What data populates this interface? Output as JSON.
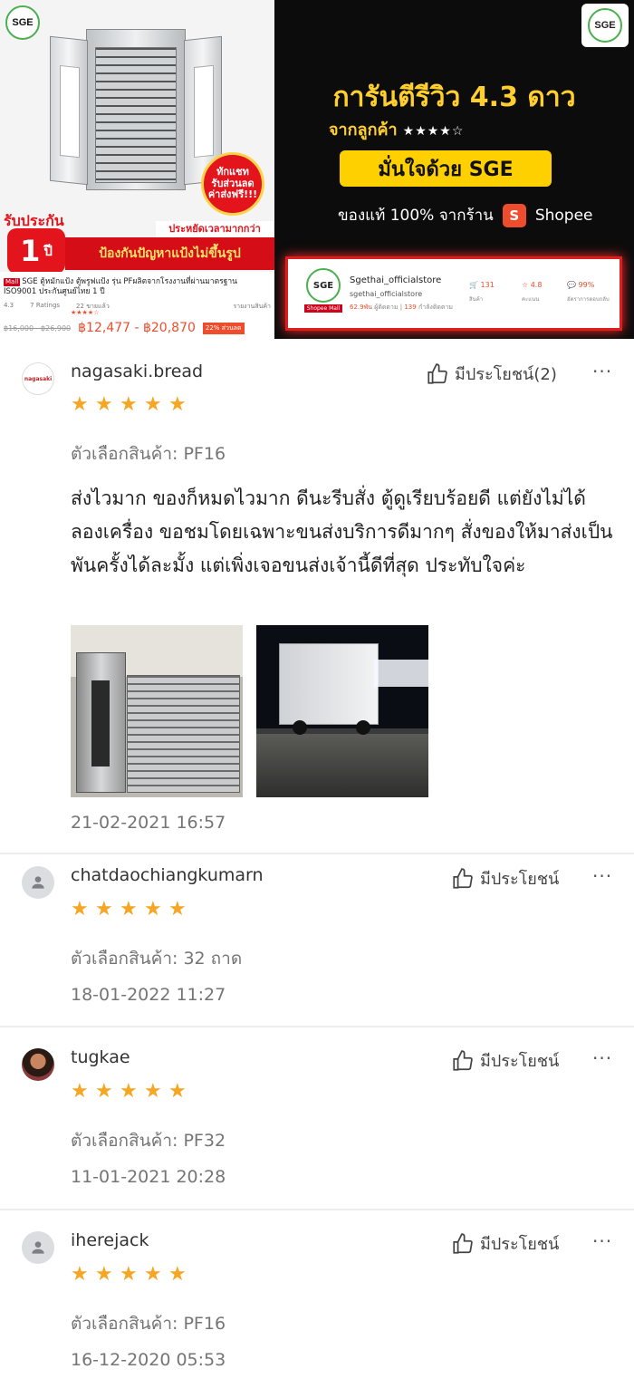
{
  "banner": {
    "left": {
      "logo_text": "SGE",
      "badge_lines": [
        "ทักแชท",
        "รับส่วนลด",
        "ค่าส่งฟรี!!!"
      ],
      "warranty_title": "รับประกัน",
      "warranty_number": "1",
      "warranty_unit": "ปี",
      "save_time": "ประหยัดเวลามากกว่า",
      "prevent_text": "ป้องกันปัญหาแป้งไม่ขึ้นรูป",
      "mall_tag": "Mall",
      "product_title": "SGE ตู้หมักแป้ง ตู้พรูฟแป้ง รุ่น PFผลิตจากโรงงานที่ผ่านมาตรฐาน ISO9001 ประกันศูนย์ไทย 1 ปี",
      "rating": "4.3",
      "rating_stars": "★★★★☆",
      "ratings_count": "7 Ratings",
      "sold": "22",
      "sold_label": "ขายแล้ว",
      "report": "รายงานสินค้า",
      "price_old": "฿16,000 - ฿26,900",
      "price_new": "฿12,477 - ฿20,870",
      "discount": "22% ส่วนลด"
    },
    "right": {
      "logo_text": "SGE",
      "guarantee": "การันตีรีวิว 4.3 ดาว",
      "from_customer": "จากลูกค้า",
      "from_customer_stars": "★★★★☆",
      "confident": "มั่นใจด้วย SGE",
      "authentic": "ของแท้ 100% จากร้าน",
      "shopee_icon": "S",
      "shopee": "Shopee",
      "store": {
        "logo_text": "SGE",
        "mall_label": "Shopee Mall",
        "name": "Sgethai_officialstore",
        "handle": "sgethai_officialstore",
        "followers": "62.9พัน",
        "followers_label": "ผู้ติดตาม",
        "following": "139",
        "following_label": "กำลังติดตาม",
        "products": "131",
        "products_label": "สินค้า",
        "score": "4.8",
        "score_label": "คะแนน",
        "chat_rate": "99%",
        "chat_rate_label": "อัตราการตอบกลับ"
      }
    }
  },
  "reviews": [
    {
      "username": "nagasaki.bread",
      "avatar_icon": "nagasaki-logo",
      "helpful": "มีประโยชน์(2)",
      "stars": 5,
      "variation": "ตัวเลือกสินค้า: PF16",
      "text": "ส่งไวมาก ของก็หมดไวมาก ดีนะรีบสั่ง ตู้ดูเรียบร้อยดี แต่ยังไม่ได้ลองเครื่อง ขอชมโดยเฉพาะขนส่งบริการดีมากๆ สั่งของให้มาส่งเป็นพันครั้งได้ละมั้ง แต่เพิ่งเจอขนส่งเจ้านี้ดีที่สุด ประทับใจค่ะ",
      "date": "21-02-2021 16:57"
    },
    {
      "username": "chatdaochiangkumarn",
      "avatar_icon": "default-user-icon",
      "helpful": "มีประโยชน์",
      "stars": 5,
      "variation": "ตัวเลือกสินค้า: 32 ถาด",
      "date": "18-01-2022 11:27"
    },
    {
      "username": "tugkae",
      "avatar_icon": "user-photo",
      "helpful": "มีประโยชน์",
      "stars": 5,
      "variation": "ตัวเลือกสินค้า: PF32",
      "date": "11-01-2021 20:28"
    },
    {
      "username": "iherejack",
      "avatar_icon": "default-user-icon",
      "helpful": "มีประโยชน์",
      "stars": 5,
      "variation": "ตัวเลือกสินค้า: PF16",
      "date": "16-12-2020 05:53"
    }
  ],
  "ui": {
    "more_icon": "···",
    "star_glyph": "★",
    "nagasaki_logo_text": "nagasaki"
  },
  "colors": {
    "star": "#f5a623",
    "shopee_orange": "#ee4d2d",
    "banner_gold": "#ffcf2e"
  }
}
